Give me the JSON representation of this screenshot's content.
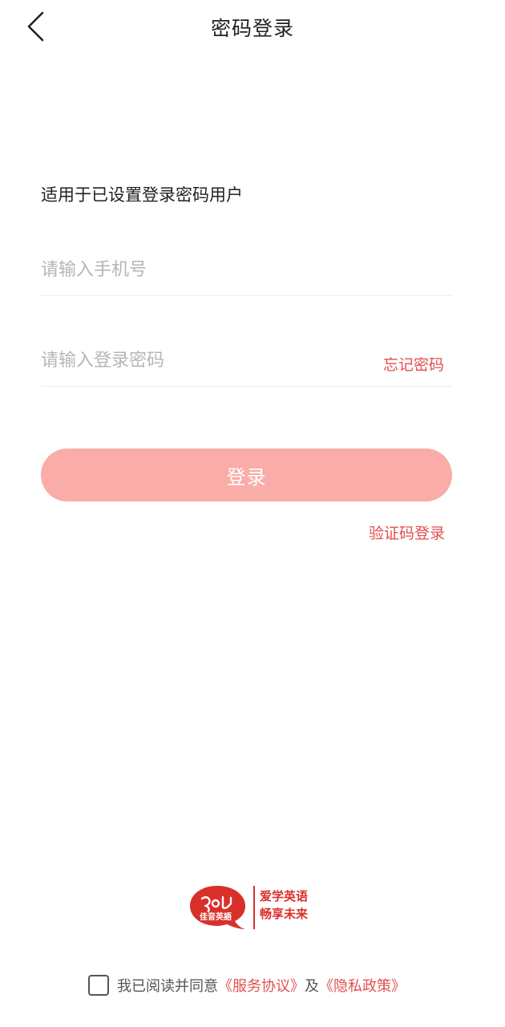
{
  "header": {
    "title": "密码登录",
    "back_icon": "chevron-left-icon"
  },
  "form": {
    "hint": "适用于已设置登录密码用户",
    "phone_placeholder": "请输入手机号",
    "password_placeholder": "请输入登录密码",
    "forgot_password": "忘记密码",
    "login_button": "登录",
    "code_login": "验证码登录"
  },
  "brand": {
    "name": "佳音英語",
    "slogan_line1": "爱学英语",
    "slogan_line2": "畅享未来"
  },
  "agreement": {
    "checked": false,
    "prefix": "我已阅读并同意",
    "service_link": "《服务协议》",
    "joiner": "及",
    "privacy_link": "《隐私政策》"
  },
  "colors": {
    "accent": "#e24f4f",
    "button_disabled": "#f9aca8",
    "brand_red": "#d9302c"
  }
}
